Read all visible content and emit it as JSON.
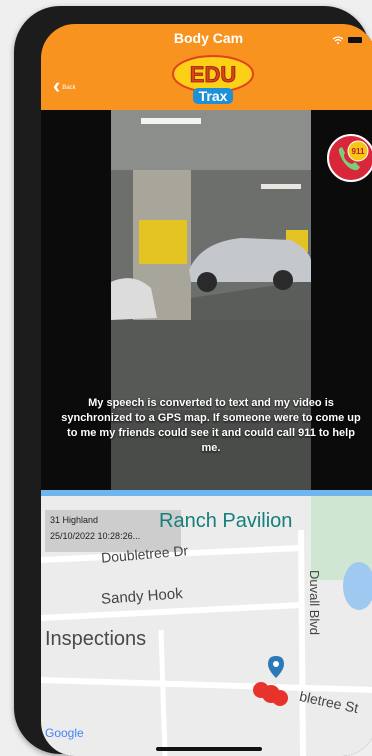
{
  "app": {
    "title": "Body Cam",
    "back_label": "Back",
    "logo_text_top": "EDU",
    "logo_text_bottom": "Trax"
  },
  "video": {
    "caption": "My speech is converted to text and my video is synchronized to a GPS map. If someone were to come up to me my friends could see it and could call 911 to help me.",
    "emergency_button_label": "911"
  },
  "map": {
    "info_line1": "31   Highland",
    "info_line2": "25/10/2022 10:28:26...",
    "labels": {
      "ranch_pavilion": "Ranch Pavilion",
      "doubletree_dr": "Doubletree Dr",
      "sandy_hook": "Sandy Hook",
      "inspections": "Inspections",
      "duvall_blvd": "Duvall Blvd",
      "doubletree_st": "bletree St",
      "google": "Google"
    }
  },
  "colors": {
    "header": "#f7931e",
    "accent_red": "#d8263a",
    "map_teal": "#15807b",
    "map_bar": "#6fb6ee"
  },
  "icons": [
    "wifi-icon",
    "battery-icon",
    "back-chevron-icon",
    "phone-911-icon",
    "location-pin-icon"
  ]
}
